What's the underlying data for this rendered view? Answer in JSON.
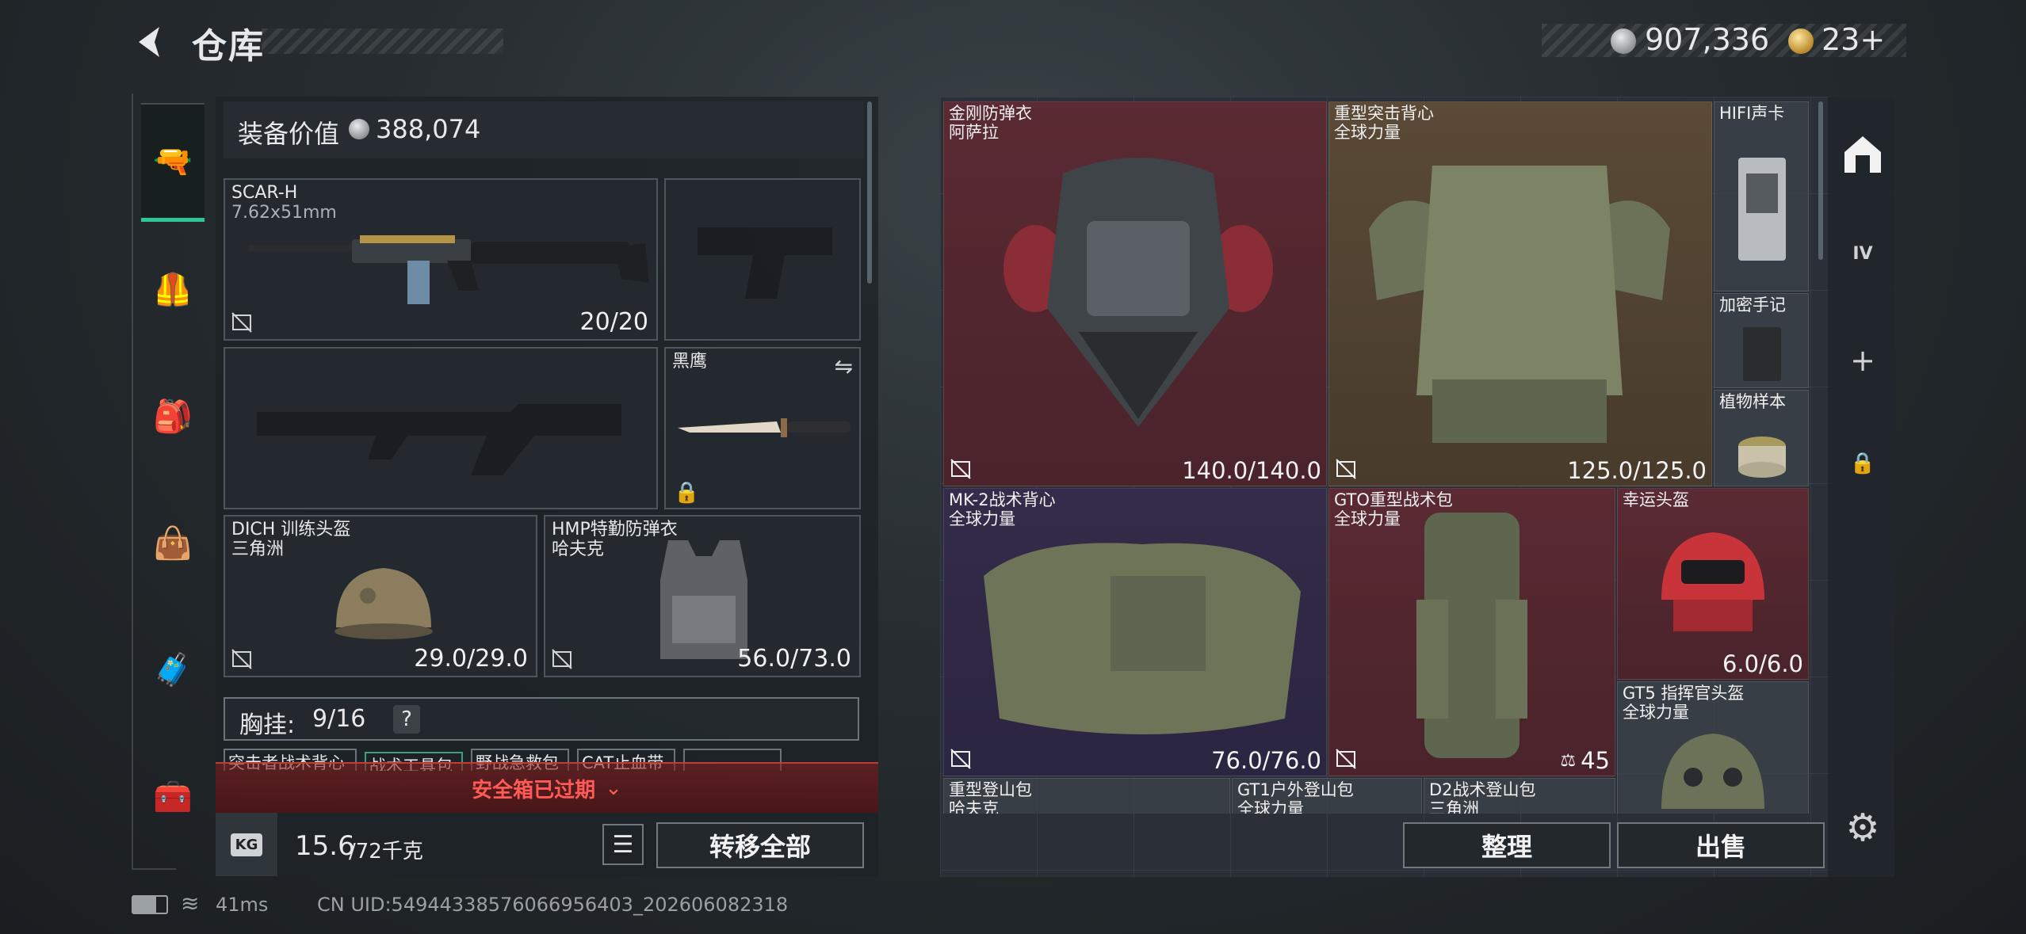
{
  "header": {
    "title": "仓库",
    "money": "907,336",
    "tickets": "23+"
  },
  "nav": {
    "items": [
      "weapon",
      "vest",
      "backpack",
      "bag",
      "case",
      "toolbox"
    ]
  },
  "loadout": {
    "value_label": "装备价值",
    "value": "388,074",
    "primary": {
      "name": "SCAR-H",
      "ammo": "7.62x51mm",
      "durability": "20/20"
    },
    "melee": {
      "name": "黑鹰"
    },
    "helmet": {
      "name": "DICH 训练头盔",
      "source": "三角洲",
      "durability": "29.0/29.0"
    },
    "armor": {
      "name": "HMP特勤防弹衣",
      "source": "哈夫克",
      "durability": "56.0/73.0"
    },
    "chest_rig": {
      "label": "胸挂:",
      "capacity": "9/16",
      "help": "?"
    },
    "peek_items": [
      "突击者战术背心",
      "战术工具包",
      "野战急救包",
      "CAT止血带",
      ""
    ],
    "safebox_notice": "安全箱已过期",
    "weight": "15.6",
    "weight_max": "/72千克",
    "weight_icon": "KG",
    "transfer_all": "转移全部"
  },
  "storage": {
    "items": [
      {
        "name": "金刚防弹衣",
        "source": "阿萨拉",
        "durability": "140.0/140.0",
        "rarity": "red"
      },
      {
        "name": "重型突击背心",
        "source": "全球力量",
        "durability": "125.0/125.0",
        "rarity": "gold"
      },
      {
        "name": "HIFI声卡",
        "source": "",
        "durability": "",
        "rarity": "grey"
      },
      {
        "name": "加密手记",
        "source": "",
        "durability": "",
        "rarity": "grey"
      },
      {
        "name": "植物样本",
        "source": "",
        "durability": "",
        "rarity": "grey"
      },
      {
        "name": "MK-2战术背心",
        "source": "全球力量",
        "durability": "76.0/76.0",
        "rarity": "purple"
      },
      {
        "name": "GTO重型战术包",
        "source": "全球力量",
        "durability": "45",
        "rarity": "red"
      },
      {
        "name": "幸运头盔",
        "source": "",
        "durability": "6.0/6.0",
        "rarity": "red"
      },
      {
        "name": "GT5 指挥官头盔",
        "source": "全球力量",
        "durability": "",
        "rarity": "grey"
      },
      {
        "name": "重型登山包",
        "source": "哈夫克",
        "durability": "",
        "rarity": "grey"
      },
      {
        "name": "GT1户外登山包",
        "source": "全球力量",
        "durability": "",
        "rarity": "grey"
      },
      {
        "name": "D2战术登山包",
        "source": "三角洲",
        "durability": "",
        "rarity": "grey"
      }
    ],
    "sort_label": "整理",
    "sell_label": "出售",
    "side_label": "IV"
  },
  "status": {
    "ping": "41ms",
    "uid": "CN UID:54944338576066956403_202606082318"
  },
  "colors": {
    "accent": "#2ec79a",
    "red": "#5b2a33",
    "gold": "#5a4a36",
    "purple": "#342c4a",
    "danger": "#ff5a55"
  }
}
